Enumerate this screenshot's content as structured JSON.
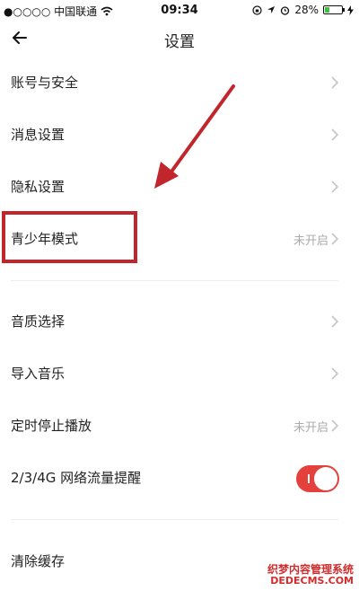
{
  "status_bar": {
    "carrier": "●○○○○ 中国联通",
    "time": "09:34",
    "battery": "28%",
    "battery_level": 0.28
  },
  "header": {
    "title": "设置",
    "back_icon": "arrow-left-icon"
  },
  "settings": {
    "account_security": "账号与安全",
    "message_settings": "消息设置",
    "privacy_settings": "隐私设置",
    "youth_mode": {
      "label": "青少年模式",
      "value": "未开启"
    },
    "audio_quality": "音质选择",
    "import_music": "导入音乐",
    "sleep_timer": {
      "label": "定时停止播放",
      "value": "未开启"
    },
    "data_alert": {
      "label": "2/3/4G 网络流量提醒",
      "enabled": true
    },
    "clear_cache": "清除缓存"
  },
  "watermark": {
    "line1": "织梦内容管理系统",
    "line2": "DEDECMS.COM"
  },
  "colors": {
    "accent_red": "#e4403c",
    "annotation_red": "#c0262c"
  }
}
